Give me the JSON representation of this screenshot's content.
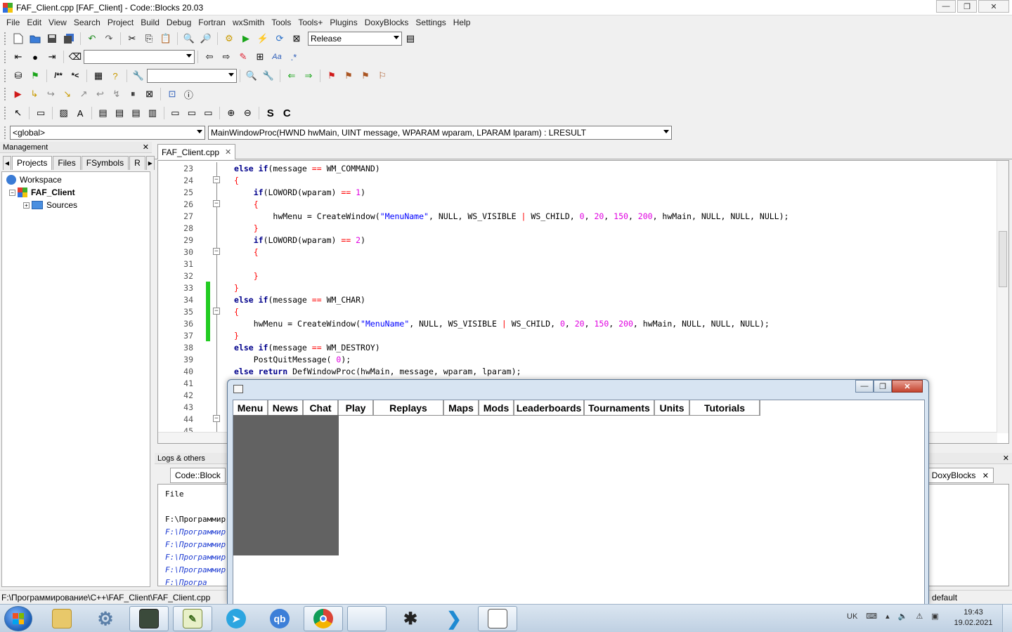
{
  "window": {
    "title": "FAF_Client.cpp [FAF_Client] - Code::Blocks 20.03",
    "minimize": "—",
    "maximize": "❐",
    "close": "✕"
  },
  "menubar": [
    "File",
    "Edit",
    "View",
    "Search",
    "Project",
    "Build",
    "Debug",
    "Fortran",
    "wxSmith",
    "Tools",
    "Tools+",
    "Plugins",
    "DoxyBlocks",
    "Settings",
    "Help"
  ],
  "toolbar": {
    "build_target": "Release",
    "search_combo": "",
    "symbol_combo": ""
  },
  "scopebar": {
    "scope": "<global>",
    "function": "MainWindowProc(HWND hwMain, UINT message, WPARAM wparam, LPARAM lparam) : LRESULT"
  },
  "management": {
    "title": "Management",
    "close": "✕",
    "tabs": [
      "Projects",
      "Files",
      "FSymbols",
      "R"
    ],
    "tree": {
      "workspace": "Workspace",
      "project": "FAF_Client",
      "folder": "Sources"
    }
  },
  "editor": {
    "tab_label": "FAF_Client.cpp",
    "tab_close": "✕",
    "lines": [
      {
        "n": "23",
        "fold": "line",
        "chg": false
      },
      {
        "n": "24",
        "fold": "box",
        "chg": false
      },
      {
        "n": "25",
        "fold": "line",
        "chg": false
      },
      {
        "n": "26",
        "fold": "box",
        "chg": false
      },
      {
        "n": "27",
        "fold": "line",
        "chg": false
      },
      {
        "n": "28",
        "fold": "line",
        "chg": false
      },
      {
        "n": "29",
        "fold": "line",
        "chg": false
      },
      {
        "n": "30",
        "fold": "box",
        "chg": false
      },
      {
        "n": "31",
        "fold": "line",
        "chg": false
      },
      {
        "n": "32",
        "fold": "line",
        "chg": false
      },
      {
        "n": "33",
        "fold": "line",
        "chg": true
      },
      {
        "n": "34",
        "fold": "line",
        "chg": true
      },
      {
        "n": "35",
        "fold": "box",
        "chg": true
      },
      {
        "n": "36",
        "fold": "line",
        "chg": true
      },
      {
        "n": "37",
        "fold": "line",
        "chg": true
      },
      {
        "n": "38",
        "fold": "line",
        "chg": false
      },
      {
        "n": "39",
        "fold": "line",
        "chg": false
      },
      {
        "n": "40",
        "fold": "line",
        "chg": false
      },
      {
        "n": "41",
        "fold": "line",
        "chg": false
      },
      {
        "n": "42",
        "fold": "line",
        "chg": false
      },
      {
        "n": "43",
        "fold": "line",
        "chg": false
      },
      {
        "n": "44",
        "fold": "box",
        "chg": false
      },
      {
        "n": "45",
        "fold": "line",
        "chg": false
      }
    ],
    "code": {
      "l23": {
        "kw1": "else if",
        "a": "(message ",
        "op": "==",
        "b": " WM_COMMAND)"
      },
      "l24": "{",
      "l25": {
        "kw": "if",
        "a": "(LOWORD(wparam) ",
        "op": "==",
        "num": "1",
        "b": ")"
      },
      "l26": "{",
      "l27": {
        "a": "hwMenu = CreateWindow(",
        "str": "\"MenuName\"",
        "b": ", NULL, WS_VISIBLE ",
        "op": "|",
        "c": " WS_CHILD, ",
        "n1": "0",
        "n2": "20",
        "n3": "150",
        "n4": "200",
        "d": ", hwMain, NULL, NULL, NULL);"
      },
      "l28": "}",
      "l29": {
        "kw": "if",
        "a": "(LOWORD(wparam) ",
        "op": "==",
        "num": "2",
        "b": ")"
      },
      "l30": "{",
      "l32": "}",
      "l33": "}",
      "l34": {
        "kw1": "else if",
        "a": "(message ",
        "op": "==",
        "b": " WM_CHAR)"
      },
      "l35": "{",
      "l36": {
        "a": "hwMenu = CreateWindow(",
        "str": "\"MenuName\"",
        "b": ", NULL, WS_VISIBLE ",
        "op": "|",
        "c": " WS_CHILD, ",
        "n1": "0",
        "n2": "20",
        "n3": "150",
        "n4": "200",
        "d": ", hwMain, NULL, NULL, NULL);"
      },
      "l37": "}",
      "l38": {
        "kw1": "else if",
        "a": "(message ",
        "op": "==",
        "b": " WM_DESTROY)"
      },
      "l39": {
        "a": "PostQuitMessage(",
        "num": "0",
        "b": ");"
      },
      "l40": {
        "kw1": "else return",
        "a": " DefWindowProc(hwMain, message, wparam, lparam);"
      }
    }
  },
  "logs": {
    "title": "Logs & others",
    "close": "✕",
    "tab_label": "Code::Block",
    "tab_right": "DoxyBlocks",
    "tab_right_close": "✕",
    "column": "File",
    "lines": [
      "F:\\Программир",
      "F:\\Программир",
      "F:\\Программир",
      "F:\\Программир",
      "F:\\Программир",
      "F:\\Програ"
    ]
  },
  "statusbar": {
    "path": "F:\\Программирование\\C++\\FAF_Client\\FAF_Client.cpp",
    "right": "default"
  },
  "app_window": {
    "menu": [
      "Menu",
      "News",
      "Chat",
      "Play",
      "Replays",
      "Maps",
      "Mods",
      "Leaderboards",
      "Tournaments",
      "Units",
      "Tutorials"
    ],
    "min": "—",
    "max": "❐",
    "close": "✕",
    "panel_color": "#626262"
  },
  "taskbar": {
    "apps": [
      "explorer",
      "control-panel",
      "terminal",
      "notepad",
      "telegram",
      "qbittorrent",
      "chrome",
      "codeblocks",
      "bug-tool",
      "vscode",
      "faf-client"
    ],
    "qb_label": "qb",
    "lang": "UK",
    "time": "19:43",
    "date": "19.02.2021"
  }
}
